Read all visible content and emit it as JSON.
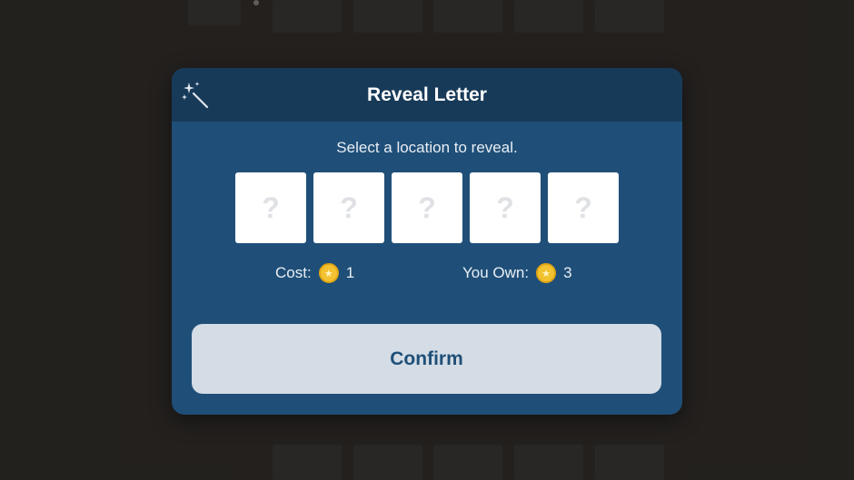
{
  "modal": {
    "title": "Reveal Letter",
    "icon": "magic-wand-icon",
    "instruction": "Select a location to reveal.",
    "slots": [
      "?",
      "?",
      "?",
      "?",
      "?"
    ],
    "cost": {
      "label": "Cost:",
      "value": "1",
      "icon": "coin-icon"
    },
    "owned": {
      "label": "You Own:",
      "value": "3",
      "icon": "coin-icon"
    },
    "confirm_label": "Confirm"
  },
  "colors": {
    "background": "#2b2926",
    "modal": "#1f4f78",
    "header": "#183a59",
    "button": "#d4dce5",
    "coin": "#f2c230"
  }
}
